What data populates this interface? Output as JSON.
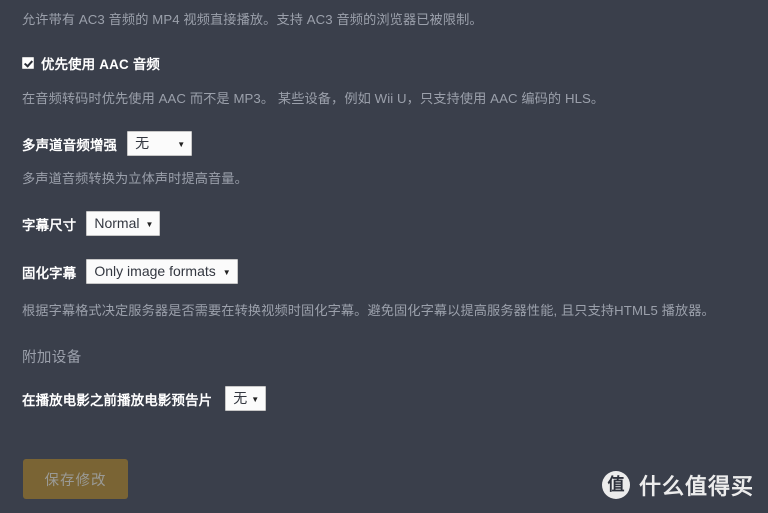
{
  "page": {
    "background_color": "#3a3f4b",
    "text_color": "#ffffff",
    "muted_text_color": "#9ba0ab"
  },
  "ac3": {
    "description": "允许带有 AC3 音频的 MP4 视频直接播放。支持 AC3 音频的浏览器已被限制。"
  },
  "aac": {
    "checkbox_label": "优先使用 AAC 音频",
    "checked": true,
    "description": "在音频转码时优先使用 AAC 而不是 MP3。 某些设备，例如 Wii U，只支持使用 AAC 编码的 HLS。"
  },
  "multichannel_boost": {
    "label": "多声道音频增强",
    "value": "无",
    "description": "多声道音频转换为立体声时提高音量。"
  },
  "subtitle_size": {
    "label": "字幕尺寸",
    "value": "Normal"
  },
  "burn_subtitles": {
    "label": "固化字幕",
    "value": "Only image formats",
    "description": "根据字幕格式决定服务器是否需要在转换视频时固化字幕。避免固化字幕以提高服务器性能, 且只支持HTML5 播放器。"
  },
  "extra_devices": {
    "heading": "附加设备"
  },
  "trailer": {
    "label": "在播放电影之前播放电影预告片",
    "value": "无"
  },
  "save": {
    "label": "保存修改",
    "color": "#7a6434"
  },
  "watermark": {
    "logo_char": "值",
    "text": "什么值得买"
  },
  "icons": {
    "caret_down": "▼",
    "checkmark": "✓"
  }
}
